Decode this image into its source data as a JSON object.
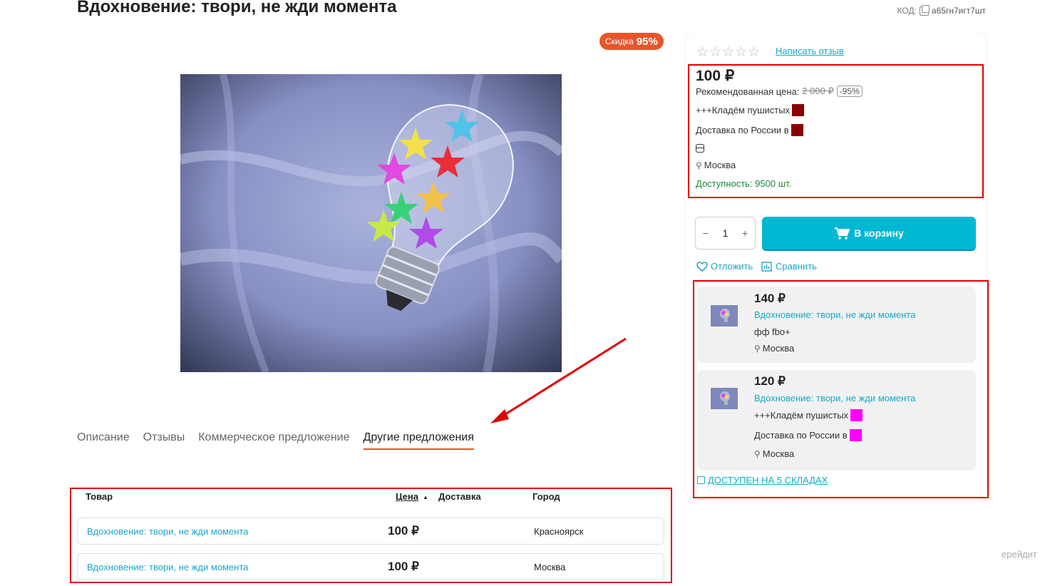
{
  "product": {
    "title": "Вдохновение: твори, не жди момента",
    "code_label": "КОД:",
    "code_value": "а65гн7игт7шт",
    "discount_label": "Скидка",
    "discount_value": "95%"
  },
  "tabs": [
    "Описание",
    "Отзывы",
    "Коммерческое предложение",
    "Другие предложения"
  ],
  "active_tab": "Другие предложения",
  "offers_table": {
    "headers": {
      "product": "Товар",
      "price": "Цена",
      "sort_arrow": "▲",
      "delivery": "Доставка",
      "city": "Город"
    },
    "rows": [
      {
        "name": "Вдохновение: твори, не жди момента",
        "price": "100 ₽",
        "city": "Красноярск"
      },
      {
        "name": "Вдохновение: твори, не жди момента",
        "price": "100 ₽",
        "city": "Москва"
      }
    ]
  },
  "card": {
    "stars": "☆☆☆☆☆",
    "rating_value": 0,
    "review_link": "Написать отзыв",
    "price": "100 ₽",
    "recommended_label": "Рекомендованная цена:",
    "recommended_price": "2 000 ₽",
    "recommended_pct": "-95%",
    "seller": "+++Кладём пушистых",
    "delivery": "Доставка по России в",
    "location": "Москва",
    "availability": "Доступность: 9500 шт.",
    "color_seller": "#8b0000",
    "qty_minus": "−",
    "qty_value": "1",
    "qty_plus": "+",
    "cart_button": "В корзину",
    "defer": "Отложить",
    "compare": "Сравнить"
  },
  "other_offers": [
    {
      "price": "140 ₽",
      "name": "Вдохновение: твори, не жди момента",
      "seller": "фф fbo+",
      "location": "Москва"
    },
    {
      "price": "120 ₽",
      "name": "Вдохновение: твори, не жди момента",
      "seller": "+++Кладём пушистых",
      "delivery": "Доставка по России в",
      "location": "Москва",
      "color_seller": "#ff00ff"
    }
  ],
  "warehouses_link": "ДОСТУПЕН НА 5 СКЛАДАХ",
  "corner_text": "ерейдит",
  "colors": {
    "accent": "#00b8d4",
    "link": "#1aa7c6",
    "discount": "#e8552a",
    "highlight": "#e00000"
  }
}
